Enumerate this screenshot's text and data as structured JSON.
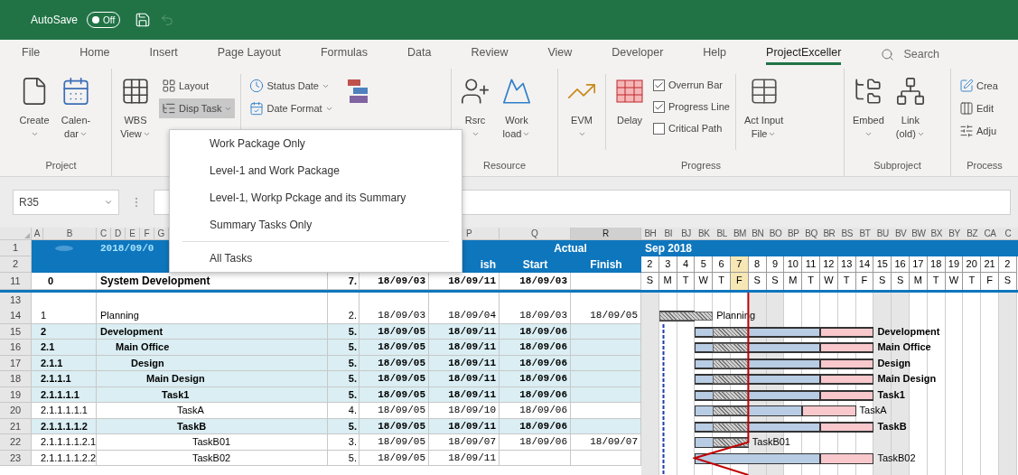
{
  "title_bar": {
    "autosave_label": "AutoSave",
    "autosave_toggle": {
      "label": "Off",
      "on": false
    }
  },
  "tabs": [
    {
      "label": "File",
      "selected": false
    },
    {
      "label": "Home",
      "selected": false
    },
    {
      "label": "Insert",
      "selected": false
    },
    {
      "label": "Page Layout",
      "selected": false
    },
    {
      "label": "Formulas",
      "selected": false
    },
    {
      "label": "Data",
      "selected": false
    },
    {
      "label": "Review",
      "selected": false
    },
    {
      "label": "View",
      "selected": false
    },
    {
      "label": "Developer",
      "selected": false
    },
    {
      "label": "Help",
      "selected": false
    },
    {
      "label": "ProjectExceller",
      "selected": true
    }
  ],
  "search": {
    "placeholder": "Search"
  },
  "ribbon": {
    "groups": [
      {
        "label": "Project",
        "items": [
          {
            "kind": "large",
            "label": [
              "Create"
            ],
            "dropdown": true
          },
          {
            "kind": "large",
            "label": [
              "Calen-",
              "dar"
            ],
            "dropdown": true
          }
        ]
      },
      {
        "items": [
          {
            "kind": "large",
            "label": [
              "WBS",
              "View"
            ],
            "dropdown": true
          },
          {
            "kind": "stack",
            "entries": [
              {
                "label": "Layout",
                "dropdown": false,
                "selected": false
              },
              {
                "label": "Disp Task",
                "dropdown": true,
                "selected": true
              }
            ]
          },
          {
            "kind": "separator"
          },
          {
            "kind": "stack",
            "entries": [
              {
                "label": "Status Date",
                "dropdown": true,
                "selected": false
              },
              {
                "label": "Date Format",
                "dropdown": true,
                "selected": false
              }
            ]
          },
          {
            "kind": "large"
          }
        ]
      },
      {
        "label": "Resource",
        "items": [
          {
            "kind": "large",
            "label": [
              "Rsrc"
            ],
            "dropdown": true
          },
          {
            "kind": "large",
            "label": [
              "Work",
              "load"
            ],
            "dropdown": true
          }
        ]
      },
      {
        "label": "Progress",
        "items": [
          {
            "kind": "large",
            "label": [
              "EVM"
            ],
            "dropdown": true
          },
          {
            "kind": "separator"
          },
          {
            "kind": "large",
            "label": [
              "Delay"
            ],
            "dropdown": false
          },
          {
            "kind": "checks",
            "entries": [
              {
                "label": "Overrun Bar",
                "checked": true
              },
              {
                "label": "Progress Line",
                "checked": true
              },
              {
                "label": "Critical Path",
                "checked": false
              }
            ]
          },
          {
            "kind": "separator"
          },
          {
            "kind": "large",
            "label": [
              "Act Input",
              "File"
            ],
            "dropdown": true
          }
        ]
      },
      {
        "label": "Subproject",
        "items": [
          {
            "kind": "large",
            "label": [
              "Embed"
            ],
            "dropdown": true
          },
          {
            "kind": "large",
            "label": [
              "Link",
              "(old)"
            ],
            "dropdown": true
          }
        ]
      },
      {
        "label": "Process",
        "items": [
          {
            "kind": "stack",
            "entries": [
              {
                "label": "Crea",
                "dropdown": false,
                "selected": false
              },
              {
                "label": "Edit",
                "dropdown": false,
                "selected": false
              },
              {
                "label": "Adju",
                "dropdown": false,
                "selected": false
              }
            ]
          }
        ]
      }
    ]
  },
  "menu": {
    "items": [
      {
        "kind": "item",
        "label": "Work Package Only"
      },
      {
        "kind": "item",
        "label": "Level-1 and Work Package"
      },
      {
        "kind": "item",
        "label": "Level-1, Workp Pckage and its Summary"
      },
      {
        "kind": "item",
        "label": "Summary Tasks Only"
      },
      {
        "kind": "separator"
      },
      {
        "kind": "item",
        "label": "All Tasks"
      }
    ]
  },
  "formula_bar": {
    "name_box": "R35"
  },
  "sheet": {
    "column_headers": [
      {
        "label": "A",
        "selected": false
      },
      {
        "label": "B",
        "selected": false
      },
      {
        "label": "C",
        "selected": false
      },
      {
        "label": "D",
        "selected": false
      },
      {
        "label": "E",
        "selected": false
      },
      {
        "label": "F",
        "selected": false
      },
      {
        "label": "G",
        "selected": false
      },
      {
        "label": "P",
        "selected": false
      },
      {
        "label": "Q",
        "selected": false
      },
      {
        "label": "R",
        "selected": true
      }
    ],
    "gantt_columns": [
      "BH",
      "BI",
      "BJ",
      "BK",
      "BL",
      "BM",
      "BN",
      "BO",
      "BP",
      "BQ",
      "BR",
      "BS",
      "BT",
      "BU",
      "BV",
      "BW",
      "BX",
      "BY",
      "BZ",
      "CA",
      "C"
    ],
    "header": {
      "rows": [
        "1",
        "2"
      ],
      "date": "2018/09/0",
      "planned_finish": "ish",
      "actual": "Actual",
      "actual_start": "Start",
      "actual_finish": "Finish",
      "month": "Sep 2018"
    },
    "days": [
      {
        "day": "2",
        "weekday": "S",
        "weekend": true,
        "today": false
      },
      {
        "day": "3",
        "weekday": "M",
        "weekend": false,
        "today": false
      },
      {
        "day": "4",
        "weekday": "T",
        "weekend": false,
        "today": false
      },
      {
        "day": "5",
        "weekday": "W",
        "weekend": false,
        "today": false
      },
      {
        "day": "6",
        "weekday": "T",
        "weekend": false,
        "today": false
      },
      {
        "day": "7",
        "weekday": "F",
        "weekend": false,
        "today": true
      },
      {
        "day": "8",
        "weekday": "S",
        "weekend": true,
        "today": false
      },
      {
        "day": "9",
        "weekday": "S",
        "weekend": true,
        "today": false
      },
      {
        "day": "10",
        "weekday": "M",
        "weekend": false,
        "today": false
      },
      {
        "day": "11",
        "weekday": "T",
        "weekend": false,
        "today": false
      },
      {
        "day": "12",
        "weekday": "W",
        "weekend": false,
        "today": false
      },
      {
        "day": "13",
        "weekday": "T",
        "weekend": false,
        "today": false
      },
      {
        "day": "14",
        "weekday": "F",
        "weekend": false,
        "today": false
      },
      {
        "day": "15",
        "weekday": "S",
        "weekend": true,
        "today": false
      },
      {
        "day": "16",
        "weekday": "S",
        "weekend": true,
        "today": false
      },
      {
        "day": "17",
        "weekday": "M",
        "weekend": false,
        "today": false
      },
      {
        "day": "18",
        "weekday": "T",
        "weekend": false,
        "today": false
      },
      {
        "day": "19",
        "weekday": "W",
        "weekend": false,
        "today": false
      },
      {
        "day": "20",
        "weekday": "T",
        "weekend": false,
        "today": false
      },
      {
        "day": "21",
        "weekday": "F",
        "weekend": false,
        "today": false
      },
      {
        "day": "2",
        "weekday": "S",
        "weekend": true,
        "today": false
      }
    ],
    "project_row": {
      "row": "11",
      "wbs": "0",
      "name": "System Development",
      "duration": "7.",
      "start": "18/09/03",
      "finish": "18/09/11",
      "actual_start": "18/09/03"
    },
    "blank_row": {
      "row": "13"
    },
    "tasks": [
      {
        "row": "14",
        "wbs": "1",
        "name": "Planning",
        "summary": false,
        "duration": "2.",
        "start": "18/09/03",
        "finish": "18/09/04",
        "actual_start": "18/09/03",
        "actual_finish": "18/09/05",
        "bar_label": "Planning"
      },
      {
        "row": "15",
        "wbs": "2",
        "name": "Development",
        "summary": true,
        "duration": "5.",
        "start": "18/09/05",
        "finish": "18/09/11",
        "actual_start": "18/09/06",
        "overrun": true,
        "bar_label": "Development",
        "children": [
          {
            "row": "16",
            "wbs": "2.1",
            "name": "Main Office",
            "summary": true,
            "duration": "5.",
            "start": "18/09/05",
            "finish": "18/09/11",
            "actual_start": "18/09/06",
            "overrun": true,
            "bar_label": "Main Office",
            "children": [
              {
                "row": "17",
                "wbs": "2.1.1",
                "name": "Design",
                "summary": true,
                "duration": "5.",
                "start": "18/09/05",
                "finish": "18/09/11",
                "actual_start": "18/09/06",
                "overrun": true,
                "bar_label": "Design",
                "children": [
                  {
                    "row": "18",
                    "wbs": "2.1.1.1",
                    "name": "Main Design",
                    "summary": true,
                    "duration": "5.",
                    "start": "18/09/05",
                    "finish": "18/09/11",
                    "actual_start": "18/09/06",
                    "overrun": true,
                    "bar_label": "Main Design",
                    "children": [
                      {
                        "row": "19",
                        "wbs": "2.1.1.1.1",
                        "name": "Task1",
                        "summary": true,
                        "duration": "5.",
                        "start": "18/09/05",
                        "finish": "18/09/11",
                        "actual_start": "18/09/06",
                        "overrun": true,
                        "bar_label": "Task1",
                        "children": [
                          {
                            "row": "20",
                            "wbs": "2.1.1.1.1.1",
                            "name": "TaskA",
                            "summary": false,
                            "duration": "4.",
                            "start": "18/09/05",
                            "finish": "18/09/10",
                            "actual_start": "18/09/06",
                            "overrun": true,
                            "bar_label": "TaskA"
                          },
                          {
                            "row": "21",
                            "wbs": "2.1.1.1.1.2",
                            "name": "TaskB",
                            "summary": true,
                            "duration": "5.",
                            "start": "18/09/05",
                            "finish": "18/09/11",
                            "actual_start": "18/09/06",
                            "overrun": true,
                            "bar_label": "TaskB",
                            "children": [
                              {
                                "row": "22",
                                "wbs": "2.1.1.1.1.2.1",
                                "name": "TaskB01",
                                "summary": false,
                                "duration": "3.",
                                "start": "18/09/05",
                                "finish": "18/09/07",
                                "actual_start": "18/09/06",
                                "actual_finish": "18/09/07",
                                "bar_label": "TaskB01"
                              },
                              {
                                "row": "23",
                                "wbs": "2.1.1.1.1.2.2",
                                "name": "TaskB02",
                                "summary": false,
                                "duration": "5.",
                                "start": "18/09/05",
                                "finish": "18/09/11",
                                "overrun": true,
                                "bar_label": "TaskB02"
                              }
                            ]
                          }
                        ]
                      }
                    ]
                  }
                ]
              }
            ]
          }
        ]
      }
    ]
  }
}
